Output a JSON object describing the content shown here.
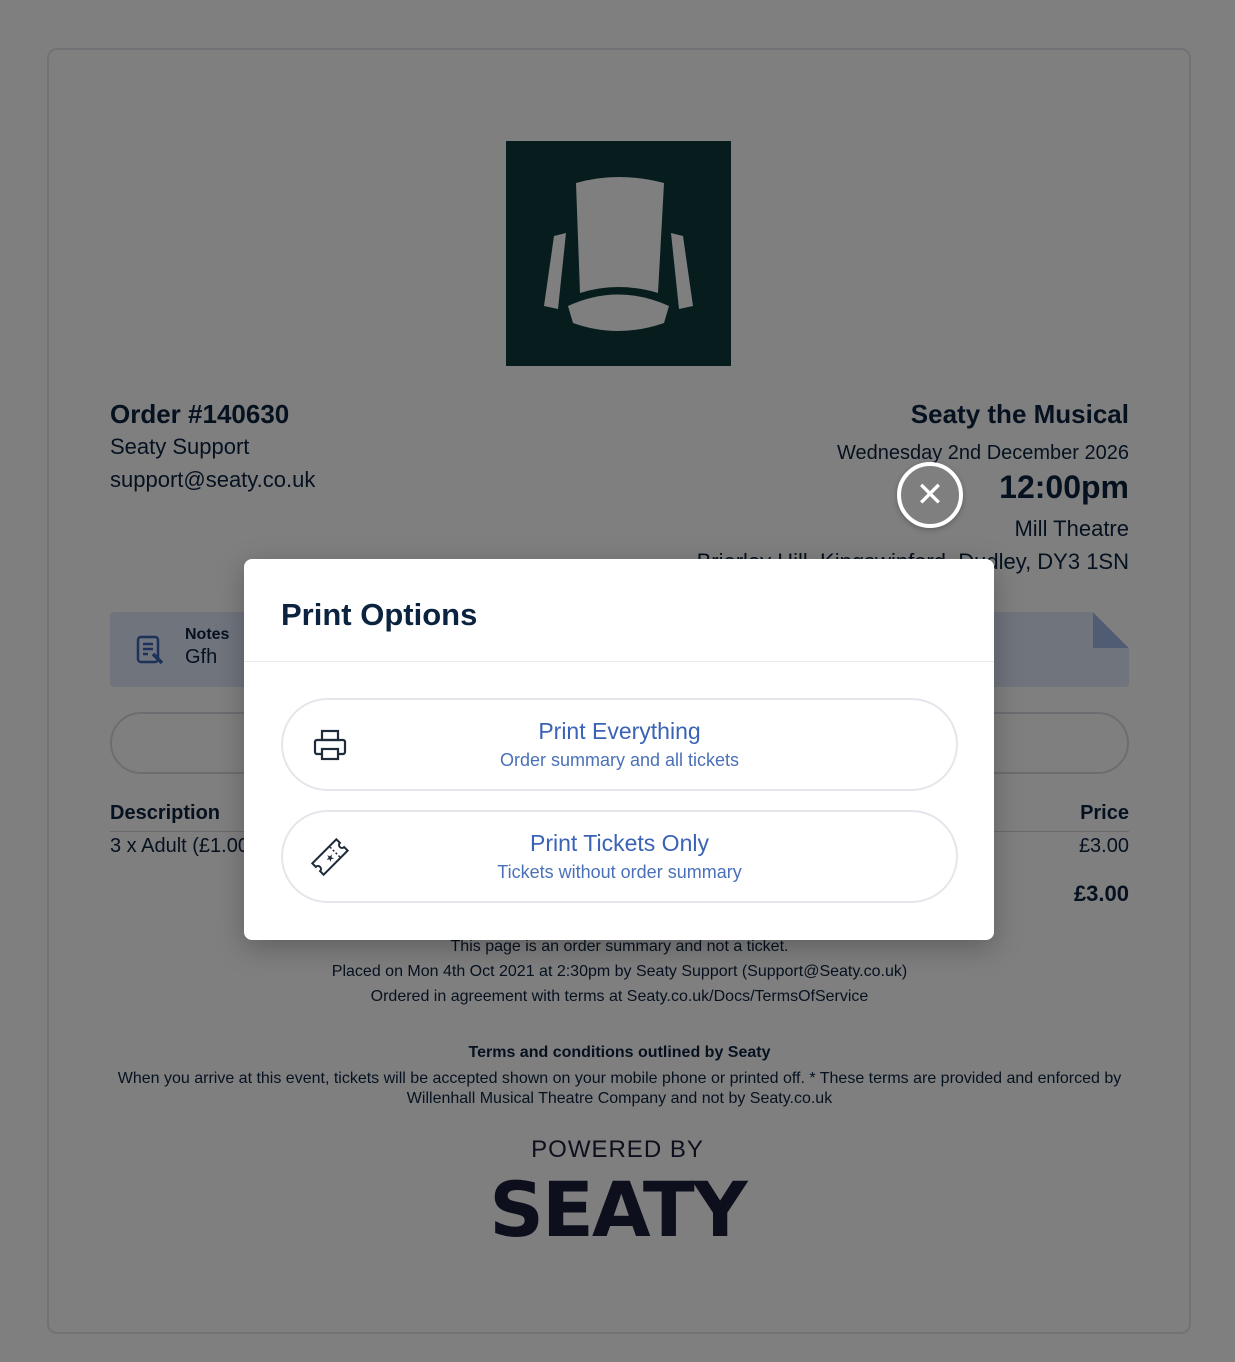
{
  "order": {
    "number": "Order #140630",
    "name": "Seaty Support",
    "email": "support@seaty.co.uk"
  },
  "event": {
    "title": "Seaty the Musical",
    "date": "Wednesday 2nd December 2026",
    "time": "12:00pm",
    "venue": "Mill Theatre",
    "address": "Brierley Hill, Kingswinford, Dudley, DY3 1SN"
  },
  "notes": {
    "label": "Notes",
    "value": "Gfh"
  },
  "table": {
    "header_description": "Description",
    "header_price": "Price",
    "rows": [
      {
        "description": "3 x Adult (£1.00",
        "price": "£3.00"
      }
    ],
    "total": "£3.00"
  },
  "footer": {
    "line1": "This page is an order summary and not a ticket.",
    "line2": "Placed on Mon 4th Oct 2021 at 2:30pm by Seaty Support (Support@Seaty.co.uk)",
    "line3": "Ordered in agreement with terms at Seaty.co.uk/Docs/TermsOfService",
    "terms_title": "Terms and conditions outlined by Seaty",
    "terms_body": "When you arrive at this event, tickets will be accepted shown on your mobile phone or printed off. * These terms are provided and enforced by Willenhall Musical Theatre Company and not by Seaty.co.uk",
    "powered_by": "POWERED BY",
    "brand": "SEATY"
  },
  "modal": {
    "title": "Print Options",
    "close_icon": "close-icon",
    "options": [
      {
        "title": "Print Everything",
        "subtitle": "Order summary and all tickets",
        "icon": "printer-icon"
      },
      {
        "title": "Print Tickets Only",
        "subtitle": "Tickets without order summary",
        "icon": "ticket-icon"
      }
    ]
  },
  "colors": {
    "accent": "#3a63b5",
    "text": "#0c2340",
    "overlay": "rgba(0,0,0,0.5)",
    "logo_bg": "#0f3a3a"
  }
}
